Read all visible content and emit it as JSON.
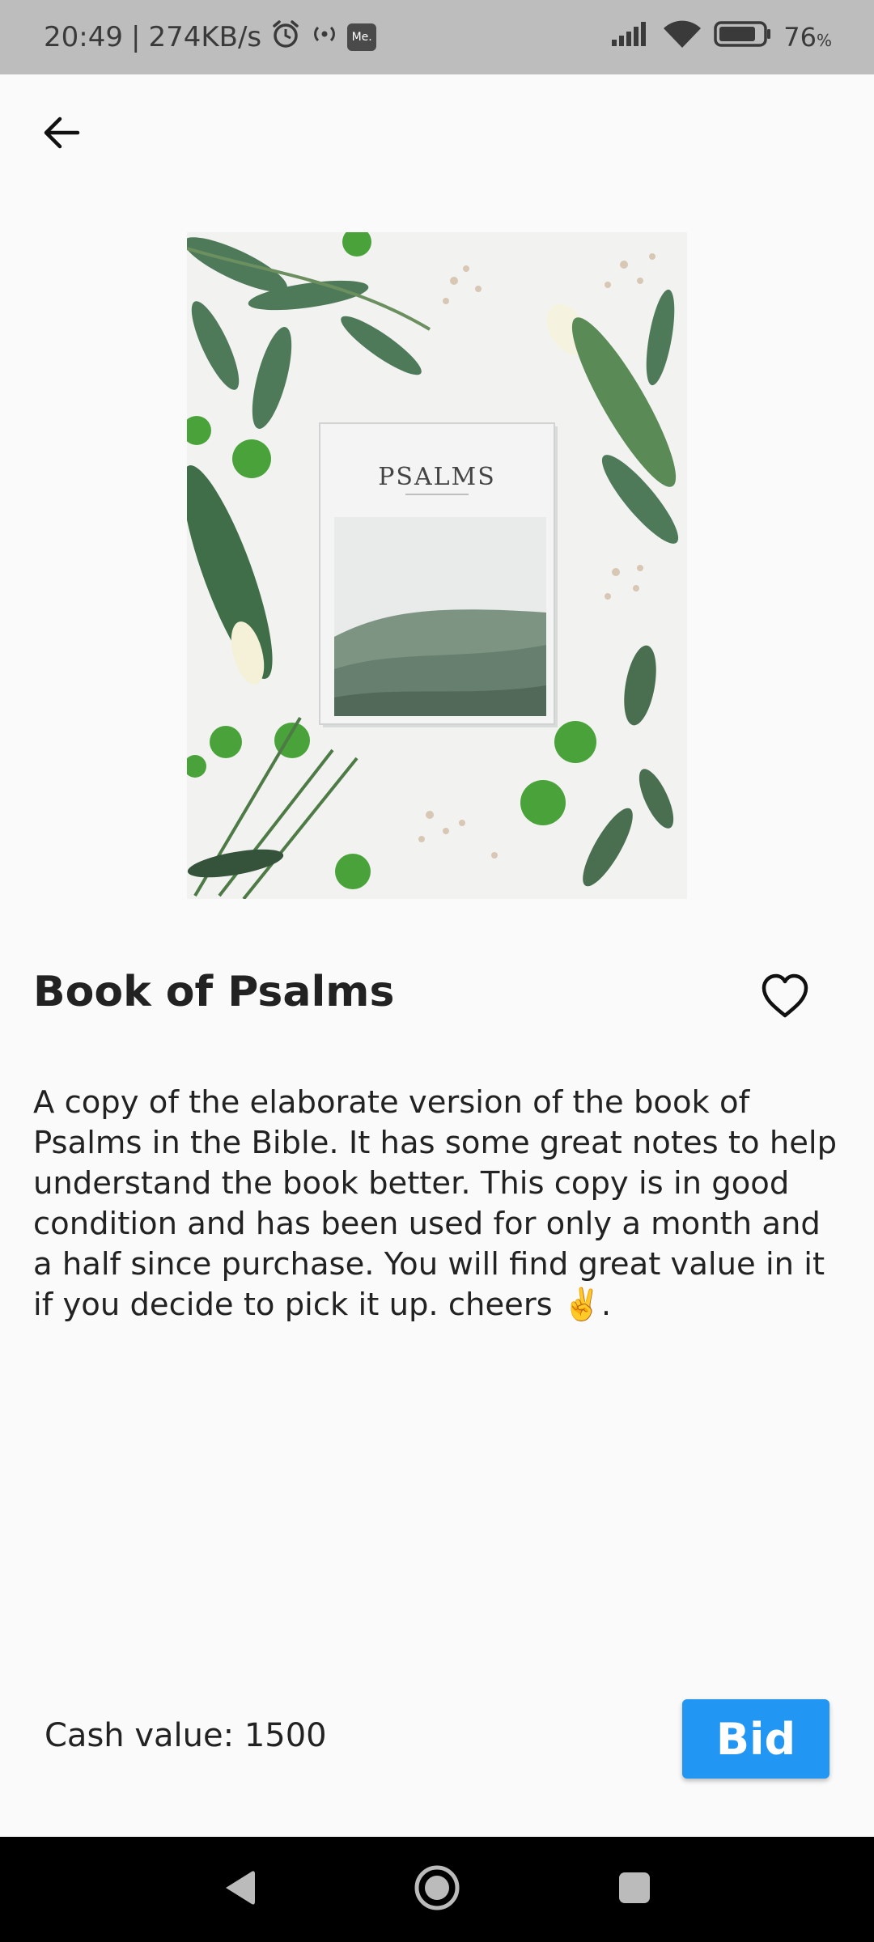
{
  "status_bar": {
    "time": "20:49",
    "separator": "|",
    "network_speed": "274KB/s",
    "me_badge": "Me.",
    "battery_level": "76",
    "battery_unit": "%"
  },
  "product": {
    "image_cover_title": "PSALMS",
    "title": "Book of Psalms",
    "description": "A copy of the elaborate version of the book of Psalms in the Bible. It has some great notes to help understand the book better. This copy is in good condition and has been used for only a month and a half since purchase. You will find great value in it if you decide to pick it up. cheers ✌️.",
    "cash_value_label": "Cash value:",
    "cash_value": "1500"
  },
  "actions": {
    "bid_label": "Bid"
  },
  "icons": {
    "back": "arrow-back-icon",
    "favorite": "heart-outline-icon",
    "nav_back": "triangle-back-icon",
    "nav_home": "circle-home-icon",
    "nav_recents": "square-recents-icon"
  },
  "colors": {
    "accent": "#2196f3",
    "status_bar": "#bdbdbd",
    "background": "#fafafa"
  }
}
